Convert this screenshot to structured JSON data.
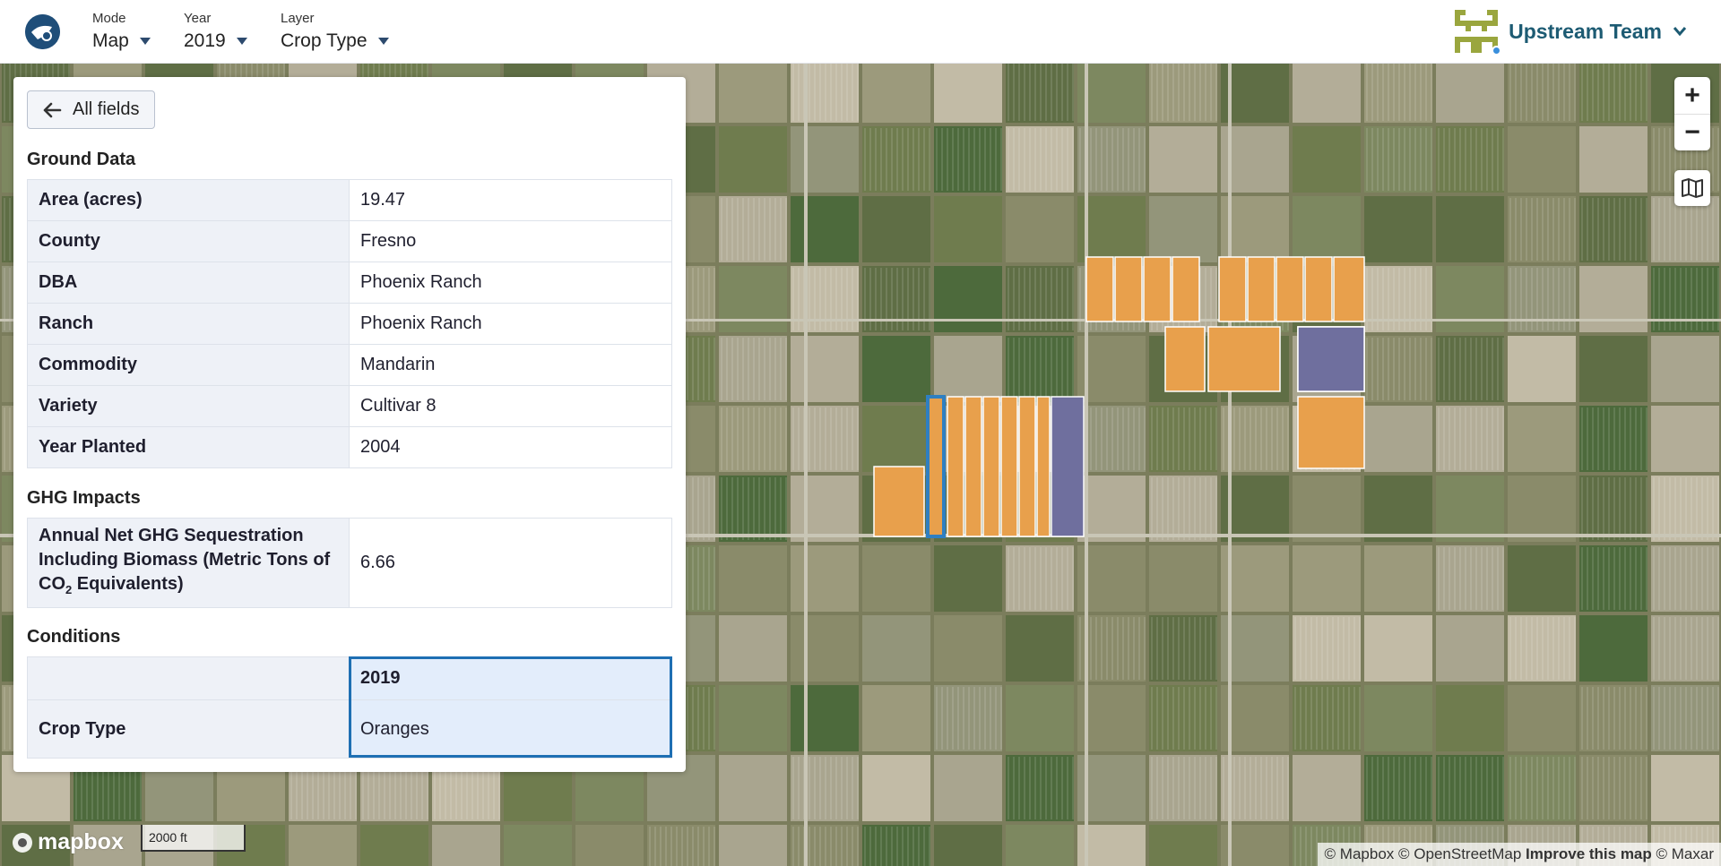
{
  "header": {
    "mode": {
      "label": "Mode",
      "value": "Map"
    },
    "year": {
      "label": "Year",
      "value": "2019"
    },
    "layer": {
      "label": "Layer",
      "value": "Crop Type"
    },
    "team_name": "Upstream Team"
  },
  "panel": {
    "back_label": "All fields",
    "ground_data_title": "Ground Data",
    "ground_data": [
      {
        "key": "Area (acres)",
        "value": "19.47"
      },
      {
        "key": "County",
        "value": "Fresno"
      },
      {
        "key": "DBA",
        "value": "Phoenix Ranch"
      },
      {
        "key": "Ranch",
        "value": "Phoenix Ranch"
      },
      {
        "key": "Commodity",
        "value": "Mandarin"
      },
      {
        "key": "Variety",
        "value": "Cultivar 8"
      },
      {
        "key": "Year Planted",
        "value": "2004"
      }
    ],
    "ghg_title": "GHG Impacts",
    "ghg": {
      "key_line1": "Annual Net GHG Sequestration",
      "key_line2": "Including Biomass (Metric Tons of",
      "key_line3_pre": "CO",
      "key_line3_sub": "2",
      "key_line3_post": " Equivalents)",
      "value": "6.66"
    },
    "conditions_title": "Conditions",
    "conditions": {
      "year_header": "2019",
      "row_key": "Crop Type",
      "row_value": "Oranges"
    }
  },
  "map": {
    "zoom_in": "+",
    "zoom_out": "−",
    "scale_label": "2000 ft",
    "mapbox_label": "mapbox",
    "attribution_mapbox": "© Mapbox",
    "attribution_osm": "© OpenStreetMap",
    "attribution_improve": "Improve this map",
    "attribution_maxar": "© Maxar",
    "colors": {
      "orange": "#e8a04c",
      "purple": "#6f6f9e",
      "selected": "#2f7fc1"
    }
  }
}
